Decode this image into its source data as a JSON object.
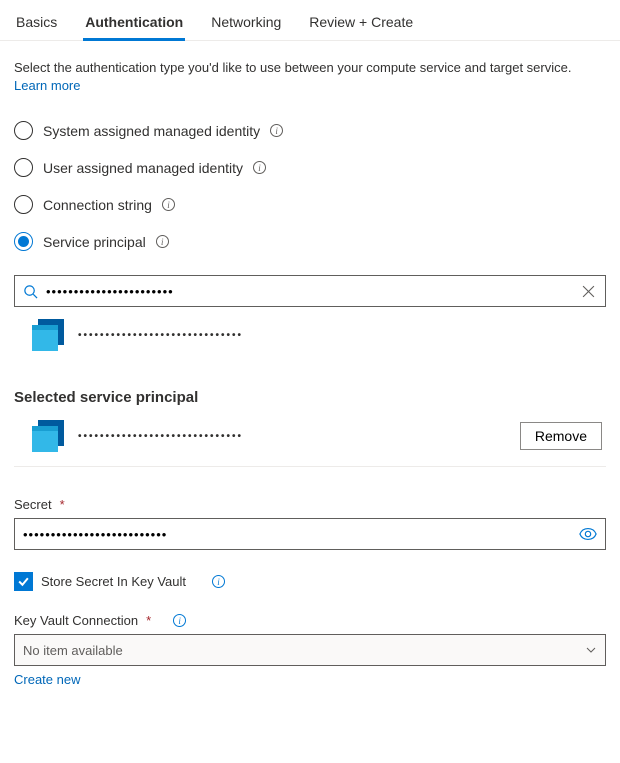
{
  "tabs": [
    {
      "label": "Basics",
      "active": false
    },
    {
      "label": "Authentication",
      "active": true
    },
    {
      "label": "Networking",
      "active": false
    },
    {
      "label": "Review + Create",
      "active": false
    }
  ],
  "description": "Select the authentication type you'd like to use between your compute service and target service.",
  "learn_more": "Learn more",
  "auth_options": [
    {
      "label": "System assigned managed identity",
      "selected": false
    },
    {
      "label": "User assigned managed identity",
      "selected": false
    },
    {
      "label": "Connection string",
      "selected": false
    },
    {
      "label": "Service principal",
      "selected": true
    }
  ],
  "search": {
    "value": "•••••••••••••••••••••••",
    "result_name": "••••••••••••••••••••••••••••••"
  },
  "selected_section": {
    "title": "Selected service principal",
    "item_name": "••••••••••••••••••••••••••••••",
    "remove_label": "Remove"
  },
  "secret": {
    "label": "Secret",
    "value": "••••••••••••••••••••••••••"
  },
  "store_kv": {
    "label": "Store Secret In Key Vault",
    "checked": true
  },
  "kv_connection": {
    "label": "Key Vault Connection",
    "placeholder": "No item available",
    "create_new": "Create new"
  }
}
